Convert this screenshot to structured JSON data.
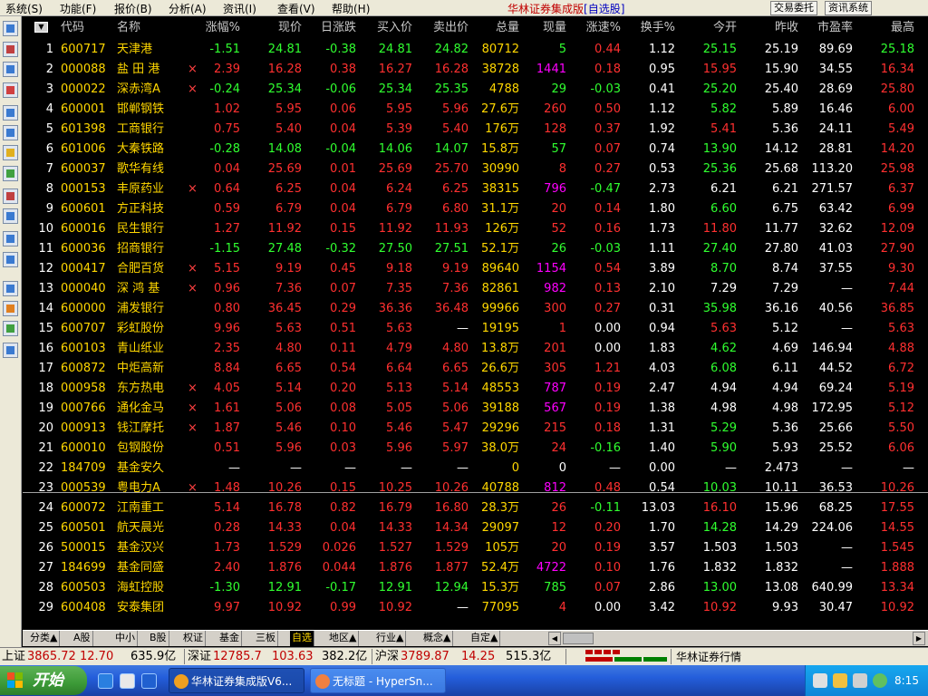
{
  "menu": {
    "items": [
      "系统(S)",
      "功能(F)",
      "报价(B)",
      "分析(A)",
      "资讯(I)",
      "查看(V)",
      "帮助(H)"
    ],
    "app_title": "华林证券集成版",
    "view_name": "[自选股]",
    "trade_button": "交易委托",
    "info_button": "资讯系统"
  },
  "table": {
    "headers": [
      "代码",
      "名称",
      "涨幅%",
      "现价",
      "日涨跌",
      "买入价",
      "卖出价",
      "总量",
      "现量",
      "涨速%",
      "换手%",
      "今开",
      "昨收",
      "市盈率",
      "最高"
    ],
    "rows": [
      {
        "n": "1",
        "code": "600717",
        "name": "天津港",
        "m": "",
        "chg": "-1.51",
        "price": "24.81",
        "diff": "-0.38",
        "bid": "24.81",
        "ask": "24.82",
        "vol": "80712",
        "cur": "5",
        "spd": "0.44",
        "turn": "1.12",
        "open": "25.15",
        "prev": "25.19",
        "pe": "89.69",
        "high": "25.18"
      },
      {
        "n": "2",
        "code": "000088",
        "name": "盐 田 港",
        "m": "×",
        "chg": "2.39",
        "price": "16.28",
        "diff": "0.38",
        "bid": "16.27",
        "ask": "16.28",
        "vol": "38728",
        "cur": "1441",
        "spd": "0.18",
        "turn": "0.95",
        "open": "15.95",
        "prev": "15.90",
        "pe": "34.55",
        "high": "16.34"
      },
      {
        "n": "3",
        "code": "000022",
        "name": "深赤湾A",
        "m": "×",
        "chg": "-0.24",
        "price": "25.34",
        "diff": "-0.06",
        "bid": "25.34",
        "ask": "25.35",
        "vol": "4788",
        "cur": "29",
        "spd": "-0.03",
        "turn": "0.41",
        "open": "25.20",
        "prev": "25.40",
        "pe": "28.69",
        "high": "25.80"
      },
      {
        "n": "4",
        "code": "600001",
        "name": "邯郸钢铁",
        "m": "",
        "chg": "1.02",
        "price": "5.95",
        "diff": "0.06",
        "bid": "5.95",
        "ask": "5.96",
        "vol": "27.6万",
        "cur": "260",
        "spd": "0.50",
        "turn": "1.12",
        "open": "5.82",
        "prev": "5.89",
        "pe": "16.46",
        "high": "6.00"
      },
      {
        "n": "5",
        "code": "601398",
        "name": "工商银行",
        "m": "",
        "chg": "0.75",
        "price": "5.40",
        "diff": "0.04",
        "bid": "5.39",
        "ask": "5.40",
        "vol": "176万",
        "cur": "128",
        "spd": "0.37",
        "turn": "1.92",
        "open": "5.41",
        "prev": "5.36",
        "pe": "24.11",
        "high": "5.49"
      },
      {
        "n": "6",
        "code": "601006",
        "name": "大秦铁路",
        "m": "",
        "chg": "-0.28",
        "price": "14.08",
        "diff": "-0.04",
        "bid": "14.06",
        "ask": "14.07",
        "vol": "15.8万",
        "cur": "57",
        "spd": "0.07",
        "turn": "0.74",
        "open": "13.90",
        "prev": "14.12",
        "pe": "28.81",
        "high": "14.20"
      },
      {
        "n": "7",
        "code": "600037",
        "name": "歌华有线",
        "m": "",
        "chg": "0.04",
        "price": "25.69",
        "diff": "0.01",
        "bid": "25.69",
        "ask": "25.70",
        "vol": "30990",
        "cur": "8",
        "spd": "0.27",
        "turn": "0.53",
        "open": "25.36",
        "prev": "25.68",
        "pe": "113.20",
        "high": "25.98"
      },
      {
        "n": "8",
        "code": "000153",
        "name": "丰原药业",
        "m": "×",
        "chg": "0.64",
        "price": "6.25",
        "diff": "0.04",
        "bid": "6.24",
        "ask": "6.25",
        "vol": "38315",
        "cur": "796",
        "spd": "-0.47",
        "turn": "2.73",
        "open": "6.21",
        "prev": "6.21",
        "pe": "271.57",
        "high": "6.37"
      },
      {
        "n": "9",
        "code": "600601",
        "name": "方正科技",
        "m": "",
        "chg": "0.59",
        "price": "6.79",
        "diff": "0.04",
        "bid": "6.79",
        "ask": "6.80",
        "vol": "31.1万",
        "cur": "20",
        "spd": "0.14",
        "turn": "1.80",
        "open": "6.60",
        "prev": "6.75",
        "pe": "63.42",
        "high": "6.99"
      },
      {
        "n": "10",
        "code": "600016",
        "name": "民生银行",
        "m": "",
        "chg": "1.27",
        "price": "11.92",
        "diff": "0.15",
        "bid": "11.92",
        "ask": "11.93",
        "vol": "126万",
        "cur": "52",
        "spd": "0.16",
        "turn": "1.73",
        "open": "11.80",
        "prev": "11.77",
        "pe": "32.62",
        "high": "12.09"
      },
      {
        "n": "11",
        "code": "600036",
        "name": "招商银行",
        "m": "",
        "chg": "-1.15",
        "price": "27.48",
        "diff": "-0.32",
        "bid": "27.50",
        "ask": "27.51",
        "vol": "52.1万",
        "cur": "26",
        "spd": "-0.03",
        "turn": "1.11",
        "open": "27.40",
        "prev": "27.80",
        "pe": "41.03",
        "high": "27.90"
      },
      {
        "n": "12",
        "code": "000417",
        "name": "合肥百货",
        "m": "×",
        "chg": "5.15",
        "price": "9.19",
        "diff": "0.45",
        "bid": "9.18",
        "ask": "9.19",
        "vol": "89640",
        "cur": "1154",
        "spd": "0.54",
        "turn": "3.89",
        "open": "8.70",
        "prev": "8.74",
        "pe": "37.55",
        "high": "9.30"
      },
      {
        "n": "13",
        "code": "000040",
        "name": "深 鸿 基",
        "m": "×",
        "chg": "0.96",
        "price": "7.36",
        "diff": "0.07",
        "bid": "7.35",
        "ask": "7.36",
        "vol": "82861",
        "cur": "982",
        "spd": "0.13",
        "turn": "2.10",
        "open": "7.29",
        "prev": "7.29",
        "pe": "—",
        "high": "7.44"
      },
      {
        "n": "14",
        "code": "600000",
        "name": "浦发银行",
        "m": "",
        "chg": "0.80",
        "price": "36.45",
        "diff": "0.29",
        "bid": "36.36",
        "ask": "36.48",
        "vol": "99966",
        "cur": "300",
        "spd": "0.27",
        "turn": "0.31",
        "open": "35.98",
        "prev": "36.16",
        "pe": "40.56",
        "high": "36.85"
      },
      {
        "n": "15",
        "code": "600707",
        "name": "彩虹股份",
        "m": "",
        "chg": "9.96",
        "price": "5.63",
        "diff": "0.51",
        "bid": "5.63",
        "ask": "—",
        "vol": "19195",
        "cur": "1",
        "spd": "0.00",
        "turn": "0.94",
        "open": "5.63",
        "prev": "5.12",
        "pe": "—",
        "high": "5.63"
      },
      {
        "n": "16",
        "code": "600103",
        "name": "青山纸业",
        "m": "",
        "chg": "2.35",
        "price": "4.80",
        "diff": "0.11",
        "bid": "4.79",
        "ask": "4.80",
        "vol": "13.8万",
        "cur": "201",
        "spd": "0.00",
        "turn": "1.83",
        "open": "4.62",
        "prev": "4.69",
        "pe": "146.94",
        "high": "4.88"
      },
      {
        "n": "17",
        "code": "600872",
        "name": "中炬高新",
        "m": "",
        "chg": "8.84",
        "price": "6.65",
        "diff": "0.54",
        "bid": "6.64",
        "ask": "6.65",
        "vol": "26.6万",
        "cur": "305",
        "spd": "1.21",
        "turn": "4.03",
        "open": "6.08",
        "prev": "6.11",
        "pe": "44.52",
        "high": "6.72"
      },
      {
        "n": "18",
        "code": "000958",
        "name": "东方热电",
        "m": "×",
        "chg": "4.05",
        "price": "5.14",
        "diff": "0.20",
        "bid": "5.13",
        "ask": "5.14",
        "vol": "48553",
        "cur": "787",
        "spd": "0.19",
        "turn": "2.47",
        "open": "4.94",
        "prev": "4.94",
        "pe": "69.24",
        "high": "5.19"
      },
      {
        "n": "19",
        "code": "000766",
        "name": "通化金马",
        "m": "×",
        "chg": "1.61",
        "price": "5.06",
        "diff": "0.08",
        "bid": "5.05",
        "ask": "5.06",
        "vol": "39188",
        "cur": "567",
        "spd": "0.19",
        "turn": "1.38",
        "open": "4.98",
        "prev": "4.98",
        "pe": "172.95",
        "high": "5.12"
      },
      {
        "n": "20",
        "code": "000913",
        "name": "钱江摩托",
        "m": "×",
        "chg": "1.87",
        "price": "5.46",
        "diff": "0.10",
        "bid": "5.46",
        "ask": "5.47",
        "vol": "29296",
        "cur": "215",
        "spd": "0.18",
        "turn": "1.31",
        "open": "5.29",
        "prev": "5.36",
        "pe": "25.66",
        "high": "5.50"
      },
      {
        "n": "21",
        "code": "600010",
        "name": "包钢股份",
        "m": "",
        "chg": "0.51",
        "price": "5.96",
        "diff": "0.03",
        "bid": "5.96",
        "ask": "5.97",
        "vol": "38.0万",
        "cur": "24",
        "spd": "-0.16",
        "turn": "1.40",
        "open": "5.90",
        "prev": "5.93",
        "pe": "25.52",
        "high": "6.06"
      },
      {
        "n": "22",
        "code": "184709",
        "name": "基金安久",
        "m": "",
        "chg": "—",
        "price": "—",
        "diff": "—",
        "bid": "—",
        "ask": "—",
        "vol": "0",
        "cur": "0",
        "spd": "—",
        "turn": "0.00",
        "open": "—",
        "prev": "2.473",
        "pe": "—",
        "high": "—"
      },
      {
        "n": "23",
        "code": "000539",
        "name": "粤电力A",
        "m": "×",
        "chg": "1.48",
        "price": "10.26",
        "diff": "0.15",
        "bid": "10.25",
        "ask": "10.26",
        "vol": "40788",
        "cur": "812",
        "spd": "0.48",
        "turn": "0.54",
        "open": "10.03",
        "prev": "10.11",
        "pe": "36.53",
        "high": "10.26"
      },
      {
        "n": "24",
        "code": "600072",
        "name": "江南重工",
        "m": "",
        "chg": "5.14",
        "price": "16.78",
        "diff": "0.82",
        "bid": "16.79",
        "ask": "16.80",
        "vol": "28.3万",
        "cur": "26",
        "spd": "-0.11",
        "turn": "13.03",
        "open": "16.10",
        "prev": "15.96",
        "pe": "68.25",
        "high": "17.55"
      },
      {
        "n": "25",
        "code": "600501",
        "name": "航天晨光",
        "m": "",
        "chg": "0.28",
        "price": "14.33",
        "diff": "0.04",
        "bid": "14.33",
        "ask": "14.34",
        "vol": "29097",
        "cur": "12",
        "spd": "0.20",
        "turn": "1.70",
        "open": "14.28",
        "prev": "14.29",
        "pe": "224.06",
        "high": "14.55"
      },
      {
        "n": "26",
        "code": "500015",
        "name": "基金汉兴",
        "m": "",
        "chg": "1.73",
        "price": "1.529",
        "diff": "0.026",
        "bid": "1.527",
        "ask": "1.529",
        "vol": "105万",
        "cur": "20",
        "spd": "0.19",
        "turn": "3.57",
        "open": "1.503",
        "prev": "1.503",
        "pe": "—",
        "high": "1.545"
      },
      {
        "n": "27",
        "code": "184699",
        "name": "基金同盛",
        "m": "",
        "chg": "2.40",
        "price": "1.876",
        "diff": "0.044",
        "bid": "1.876",
        "ask": "1.877",
        "vol": "52.4万",
        "cur": "4722",
        "spd": "0.10",
        "turn": "1.76",
        "open": "1.832",
        "prev": "1.832",
        "pe": "—",
        "high": "1.888"
      },
      {
        "n": "28",
        "code": "600503",
        "name": "海虹控股",
        "m": "",
        "chg": "-1.30",
        "price": "12.91",
        "diff": "-0.17",
        "bid": "12.91",
        "ask": "12.94",
        "vol": "15.3万",
        "cur": "785",
        "spd": "0.07",
        "turn": "2.86",
        "open": "13.00",
        "prev": "13.08",
        "pe": "640.99",
        "high": "13.34"
      },
      {
        "n": "29",
        "code": "600408",
        "name": "安泰集团",
        "m": "",
        "chg": "9.97",
        "price": "10.92",
        "diff": "0.99",
        "bid": "10.92",
        "ask": "—",
        "vol": "77095",
        "cur": "4",
        "spd": "0.00",
        "turn": "3.42",
        "open": "10.92",
        "prev": "9.93",
        "pe": "30.47",
        "high": "10.92"
      }
    ]
  },
  "tabs": [
    {
      "label": "分类▲",
      "active": false
    },
    {
      "label": "A股",
      "active": false
    },
    {
      "label": "中小",
      "active": false
    },
    {
      "label": "B股",
      "active": false
    },
    {
      "label": "权证",
      "active": false
    },
    {
      "label": "基金",
      "active": false
    },
    {
      "label": "三板",
      "active": false
    },
    {
      "label": "自选",
      "active": true
    },
    {
      "label": "地区▲",
      "active": false
    },
    {
      "label": "行业▲",
      "active": false
    },
    {
      "label": "概念▲",
      "active": false
    },
    {
      "label": "自定▲",
      "active": false
    }
  ],
  "status": {
    "sh_label": "上证",
    "sh_index": "3865.72",
    "sh_change": "12.70",
    "sh_amount": "635.9亿",
    "sz_label": "深证",
    "sz_index": "12785.7",
    "sz_change": "103.63",
    "sz_amount": "382.2亿",
    "hs_label": "沪深",
    "hs_index": "3789.87",
    "hs_change": "14.25",
    "hs_amount": "515.3亿",
    "feed_label": "华林证券行情"
  },
  "taskbar": {
    "start_label": "开始",
    "tasks": [
      {
        "label": "华林证券集成版V6...",
        "active": true
      },
      {
        "label": "无标题 - HyperSn...",
        "active": false
      }
    ],
    "clock": "8:15"
  },
  "colors": {
    "up": "#ff3030",
    "down": "#30ff30",
    "flat": "#ffffff",
    "code": "#ffd700",
    "name": "#ffd700",
    "volume": "#ffd700",
    "current_up": "#ff00ff",
    "background": "#000000"
  }
}
